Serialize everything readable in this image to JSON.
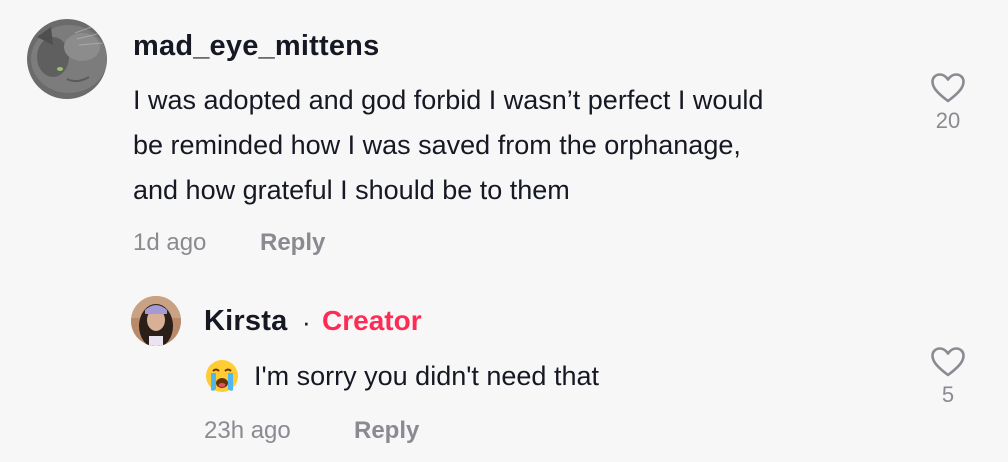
{
  "comment": {
    "username": "mad_eye_mittens",
    "avatar": "cat-avatar",
    "text_lines": [
      "I was adopted and god forbid I wasn’t perfect I would",
      "be reminded how I was saved from the orphanage,",
      "and how grateful I should be to them"
    ],
    "timestamp": "1d ago",
    "reply_label": "Reply",
    "likes": "20",
    "like_icon": "heart-outline-icon"
  },
  "reply": {
    "username": "Kirsta",
    "separator": "·",
    "badge": "Creator",
    "avatar": "person-avatar",
    "emoji": "loudly-crying-face-emoji",
    "text": "I'm sorry you didn't need that",
    "timestamp": "23h ago",
    "reply_label": "Reply",
    "likes": "5",
    "like_icon": "heart-outline-icon"
  },
  "colors": {
    "background": "#f7f7f7",
    "text_primary": "#161823",
    "text_secondary": "#8a8b91",
    "creator_accent": "#fe2c55"
  }
}
